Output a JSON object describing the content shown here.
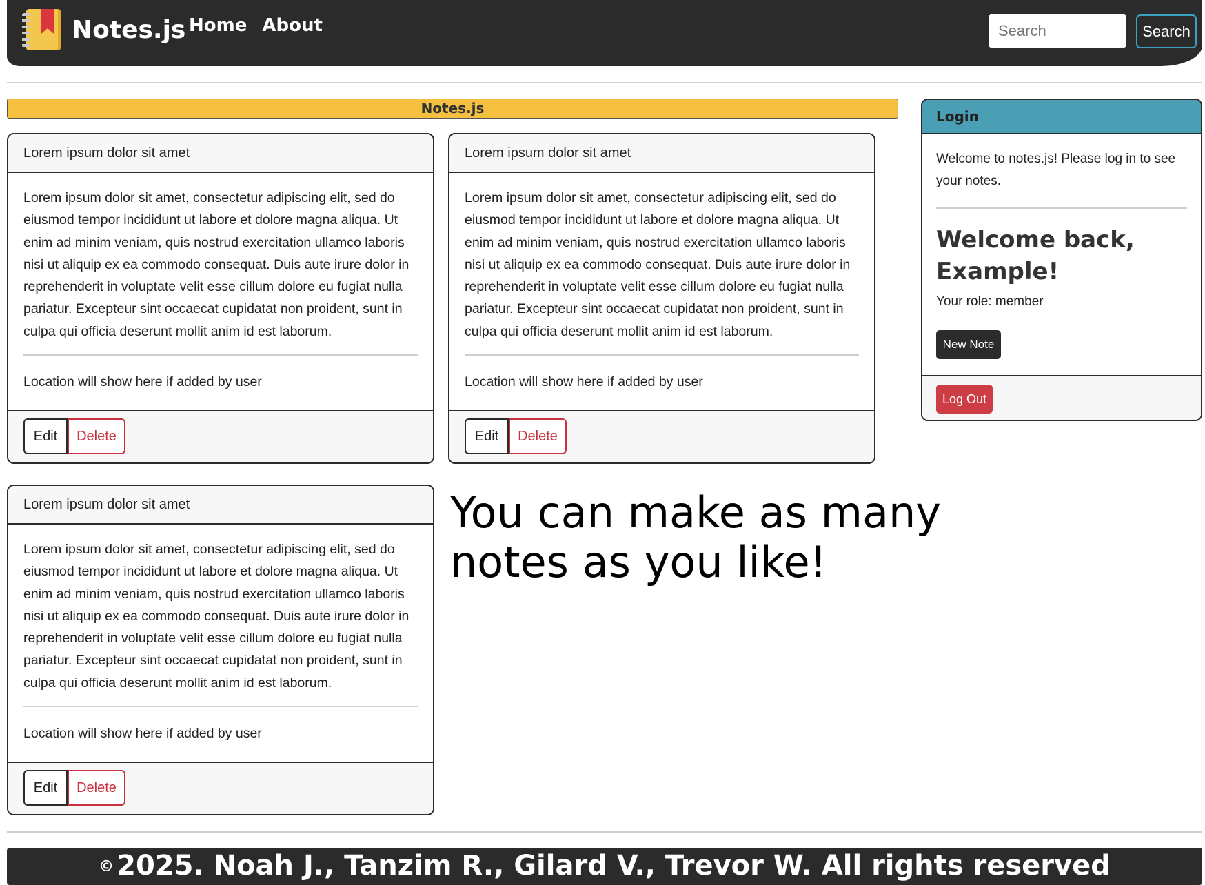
{
  "navbar": {
    "brand_name": "Notes.js",
    "brand_icon": "notebook-icon",
    "links": [
      "Home",
      "About"
    ],
    "search_placeholder": "Search",
    "search_button": "Search",
    "search_button_color": "#3aa3c2"
  },
  "banner": {
    "title": "Notes.js",
    "color": "#f5c040"
  },
  "notes": [
    {
      "title": "Lorem ipsum dolor sit amet",
      "body": "Lorem ipsum dolor sit amet, consectetur adipiscing elit, sed do eiusmod tempor incididunt ut labore et dolore magna aliqua. Ut enim ad minim veniam, quis nostrud exercitation ullamco laboris nisi ut aliquip ex ea commodo consequat. Duis aute irure dolor in reprehenderit in voluptate velit esse cillum dolore eu fugiat nulla pariatur. Excepteur sint occaecat cupidatat non proident, sunt in culpa qui officia deserunt mollit anim id est laborum.",
      "location": "Location will show here if added by user",
      "edit_label": "Edit",
      "delete_label": "Delete"
    },
    {
      "title": "Lorem ipsum dolor sit amet",
      "body": "Lorem ipsum dolor sit amet, consectetur adipiscing elit, sed do eiusmod tempor incididunt ut labore et dolore magna aliqua. Ut enim ad minim veniam, quis nostrud exercitation ullamco laboris nisi ut aliquip ex ea commodo consequat. Duis aute irure dolor in reprehenderit in voluptate velit esse cillum dolore eu fugiat nulla pariatur. Excepteur sint occaecat cupidatat non proident, sunt in culpa qui officia deserunt mollit anim id est laborum.",
      "location": "Location will show here if added by user",
      "edit_label": "Edit",
      "delete_label": "Delete"
    },
    {
      "title": "Lorem ipsum dolor sit amet",
      "body": "Lorem ipsum dolor sit amet, consectetur adipiscing elit, sed do eiusmod tempor incididunt ut labore et dolore magna aliqua. Ut enim ad minim veniam, quis nostrud exercitation ullamco laboris nisi ut aliquip ex ea commodo consequat. Duis aute irure dolor in reprehenderit in voluptate velit esse cillum dolore eu fugiat nulla pariatur. Excepteur sint occaecat cupidatat non proident, sunt in culpa qui officia deserunt mollit anim id est laborum.",
      "location": "Location will show here if added by user",
      "edit_label": "Edit",
      "delete_label": "Delete"
    }
  ],
  "login": {
    "header": "Login",
    "welcome_text": "Welcome to notes.js! Please log in to see your notes.",
    "welcome_back": "Welcome back, Example!",
    "role": "Your role: member",
    "new_note_button": "New Note",
    "logout_button": "Log Out",
    "header_color": "#4a9fb5",
    "logout_color": "#cc3d46"
  },
  "promo_text": "You can make as many notes as you like!",
  "footer": {
    "copyright_symbol": "©",
    "text": "2025. Noah J., Tanzim R., Gilard V., Trevor W. All rights reserved"
  }
}
